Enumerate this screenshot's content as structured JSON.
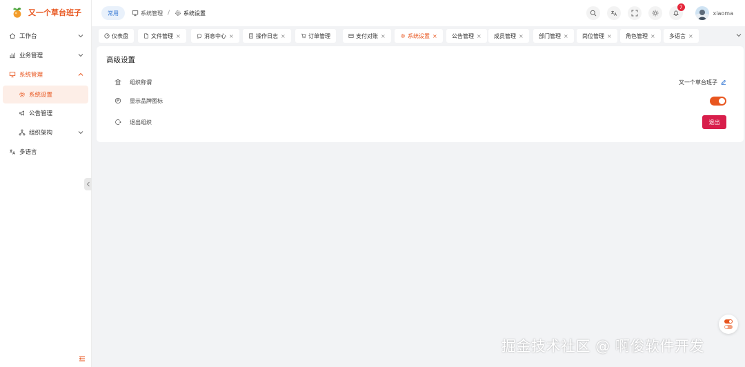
{
  "app": {
    "title": "又一个草台班子",
    "accent_color": "#e8561f",
    "danger_color": "#d81e4b"
  },
  "sidebar": {
    "items": [
      {
        "label": "工作台",
        "icon": "home-icon",
        "expandable": true
      },
      {
        "label": "业务管理",
        "icon": "chart-icon",
        "expandable": true
      },
      {
        "label": "系统管理",
        "icon": "monitor-icon",
        "expandable": true,
        "expanded": true
      },
      {
        "label": "系统设置",
        "icon": "gear-icon",
        "active": true
      },
      {
        "label": "公告管理",
        "icon": "megaphone-icon"
      },
      {
        "label": "组织架构",
        "icon": "org-icon",
        "expandable": true
      },
      {
        "label": "多语言",
        "icon": "translate-icon"
      }
    ]
  },
  "header": {
    "chip": "常用",
    "breadcrumb": [
      "系统管理",
      "系统设置"
    ],
    "breadcrumb_sep": "/",
    "notification_count": "7",
    "username": "xiaoma"
  },
  "tabs": [
    {
      "label": "仪表盘",
      "icon": "dashboard-icon",
      "closable": false
    },
    {
      "label": "文件管理",
      "icon": "file-icon",
      "closable": true
    },
    {
      "label": "消息中心",
      "icon": "message-icon",
      "closable": true
    },
    {
      "label": "操作日志",
      "icon": "log-icon",
      "closable": true
    },
    {
      "label": "订单管理",
      "icon": "cart-icon",
      "closable": true
    },
    {
      "label": "支付对账",
      "icon": "card-icon",
      "closable": true
    },
    {
      "label": "系统设置",
      "icon": "gear-icon",
      "closable": true,
      "active": true
    },
    {
      "label": "公告管理",
      "closable": true
    },
    {
      "label": "成员管理",
      "closable": true
    },
    {
      "label": "部门管理",
      "closable": true
    },
    {
      "label": "岗位管理",
      "closable": true
    },
    {
      "label": "角色管理",
      "closable": true
    },
    {
      "label": "多语言",
      "closable": true
    }
  ],
  "tab_close_glyph": "×",
  "panel": {
    "title": "高级设置",
    "rows": [
      {
        "label": "组织称谓",
        "icon": "building-icon",
        "value": "又一个草台班子"
      },
      {
        "label": "显示品牌图标",
        "icon": "brand-icon",
        "toggle_on": true
      },
      {
        "label": "退出组织",
        "icon": "logout-icon",
        "button": "退出"
      }
    ]
  },
  "watermark": "掘金技术社区 @ 啊俊软件开发"
}
